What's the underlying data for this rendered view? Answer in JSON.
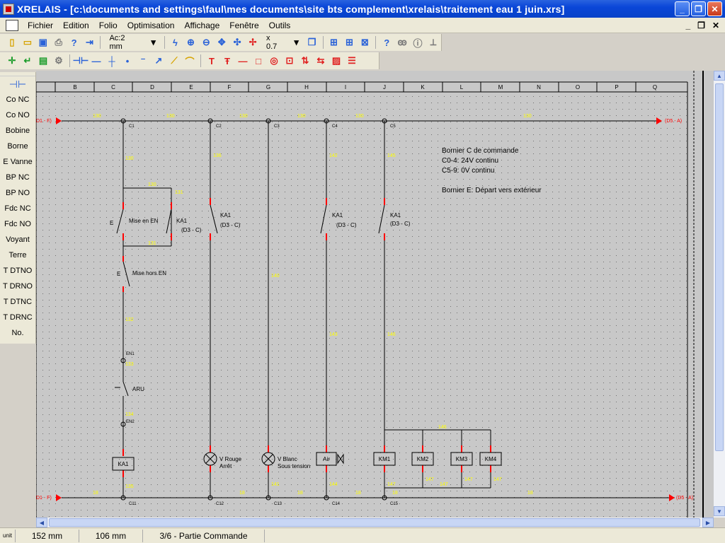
{
  "window": {
    "title": "XRELAIS - [c:\\documents and settings\\faul\\mes documents\\site bts complement\\xrelais\\traitement eau 1 juin.xrs]",
    "minimize": "_",
    "restore": "❐",
    "close": "✕"
  },
  "menu": {
    "items": [
      "Fichier",
      "Edition",
      "Folio",
      "Optimisation",
      "Affichage",
      "Fenêtre",
      "Outils"
    ],
    "mdi": [
      "_",
      "❐",
      "✕"
    ]
  },
  "toolbar": {
    "aperture_label": "Ac:2 mm",
    "zoom_label": "x 0.7"
  },
  "palette": {
    "items": [
      "Co NC",
      "Co NO",
      "Bobine",
      "Borne",
      "E Vanne",
      "BP NC",
      "BP NO",
      "Fdc NC",
      "Fdc NO",
      "Voyant",
      "Terre",
      "T DTNO",
      "T DRNO",
      "T DTNC",
      "T DRNC",
      "No."
    ]
  },
  "drawing": {
    "columns": [
      "B",
      "C",
      "D",
      "E",
      "F",
      "G",
      "H",
      "I",
      "J",
      "K",
      "L",
      "M",
      "N",
      "O",
      "P",
      "Q"
    ],
    "rail_top_left": "D1 - F)",
    "rail_top_right": "(D5 - A)",
    "rail_bottom_left": "D1 - F)",
    "rail_bottom_right": "(D5 - A)",
    "wire_top_labels": [
      "130",
      "130",
      "130",
      "130",
      "130",
      "130"
    ],
    "wire_bottom_labels": [
      "18",
      "18",
      "18",
      "18",
      "18",
      "18"
    ],
    "terminals_top": [
      "C1",
      "C2",
      "C3",
      "C4",
      "C5"
    ],
    "terminals_bottom": [
      "C11",
      "C12",
      "C13",
      "C14",
      "C15"
    ],
    "wire_numbers": [
      "130",
      "130",
      "131",
      "131",
      "132",
      "133",
      "134",
      "135",
      "136",
      "140",
      "141",
      "142",
      "143",
      "144",
      "145",
      "146",
      "147",
      "147",
      "147",
      "147",
      "147",
      "146"
    ],
    "components": {
      "mise_en": "Mise en EN",
      "mise_hors": "Mise hors EN",
      "ka1_a": "KA1",
      "ka1_a_ref": "(D3 - C)",
      "ka1_b": "KA1",
      "ka1_b_ref": "(D3 - C)",
      "ka1_c": "KA1",
      "ka1_c_ref": "(D3 - C)",
      "ka1_d": "KA1",
      "ka1_d_ref": "(D3 - C)",
      "aru": "ARU",
      "en1": "EN1",
      "en2": "EN2",
      "coil": "KA1",
      "lamp_red_1": "V Rouge",
      "lamp_red_2": "Arrêt",
      "lamp_white_1": "V Blanc",
      "lamp_white_2": "Sous tension",
      "air": "Air",
      "km1": "KM1",
      "km2": "KM2",
      "km3": "KM3",
      "km4": "KM4",
      "e_label": "E"
    },
    "notes": [
      "Bornier C de commande",
      "C0-4: 24V continu",
      "C5-9: 0V continu",
      "",
      "Bornier E: Départ vers extérieur"
    ]
  },
  "status": {
    "unit": "unit",
    "x": "152 mm",
    "y": "106 mm",
    "folio": "3/6 - Partie Commande"
  },
  "colors": {
    "wire": "#000000",
    "rail_arrow": "#ff0000",
    "wire_number": "#ffff00",
    "grid_bg": "#c8c8c8"
  }
}
